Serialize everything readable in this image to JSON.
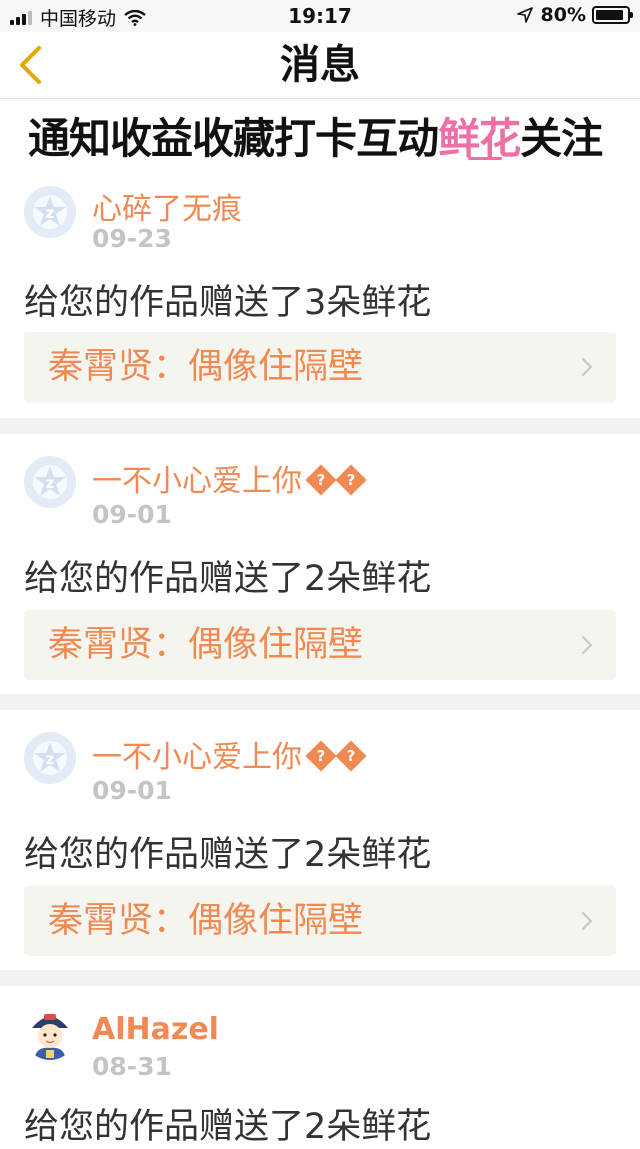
{
  "status_bar": {
    "carrier": "中国移动",
    "time": "19:17",
    "battery": "80%",
    "battery_level": 0.8
  },
  "nav": {
    "title": "消息"
  },
  "tabs": [
    {
      "label": "通知"
    },
    {
      "label": "收益"
    },
    {
      "label": "收藏"
    },
    {
      "label": "打卡"
    },
    {
      "label": "互动"
    },
    {
      "label": "鲜花",
      "active": true
    },
    {
      "label": "关注"
    }
  ],
  "messages": [
    {
      "username": "心碎了无痕",
      "date": "09-23",
      "text": "给您的作品赠送了3朵鲜花",
      "work_title": "秦霄贤：偶像住隔壁",
      "avatar": "default-qq-avatar"
    },
    {
      "username": "一不小心爱上你",
      "username_suffix": "??",
      "date": "09-01",
      "text": "给您的作品赠送了2朵鲜花",
      "work_title": "秦霄贤：偶像住隔壁",
      "avatar": "default-qq-avatar"
    },
    {
      "username": "一不小心爱上你",
      "username_suffix": "??",
      "date": "09-01",
      "text": "给您的作品赠送了2朵鲜花",
      "work_title": "秦霄贤：偶像住隔壁",
      "avatar": "default-qq-avatar"
    },
    {
      "username": "AlHazel",
      "date": "08-31",
      "text": "给您的作品赠送了2朵鲜花",
      "avatar": "cartoon-avatar"
    }
  ],
  "colors": {
    "accent_pink": "#ee6fa5",
    "orange": "#f08a52",
    "date_gray": "#c4c4c4",
    "back_arrow": "#e0a800"
  }
}
